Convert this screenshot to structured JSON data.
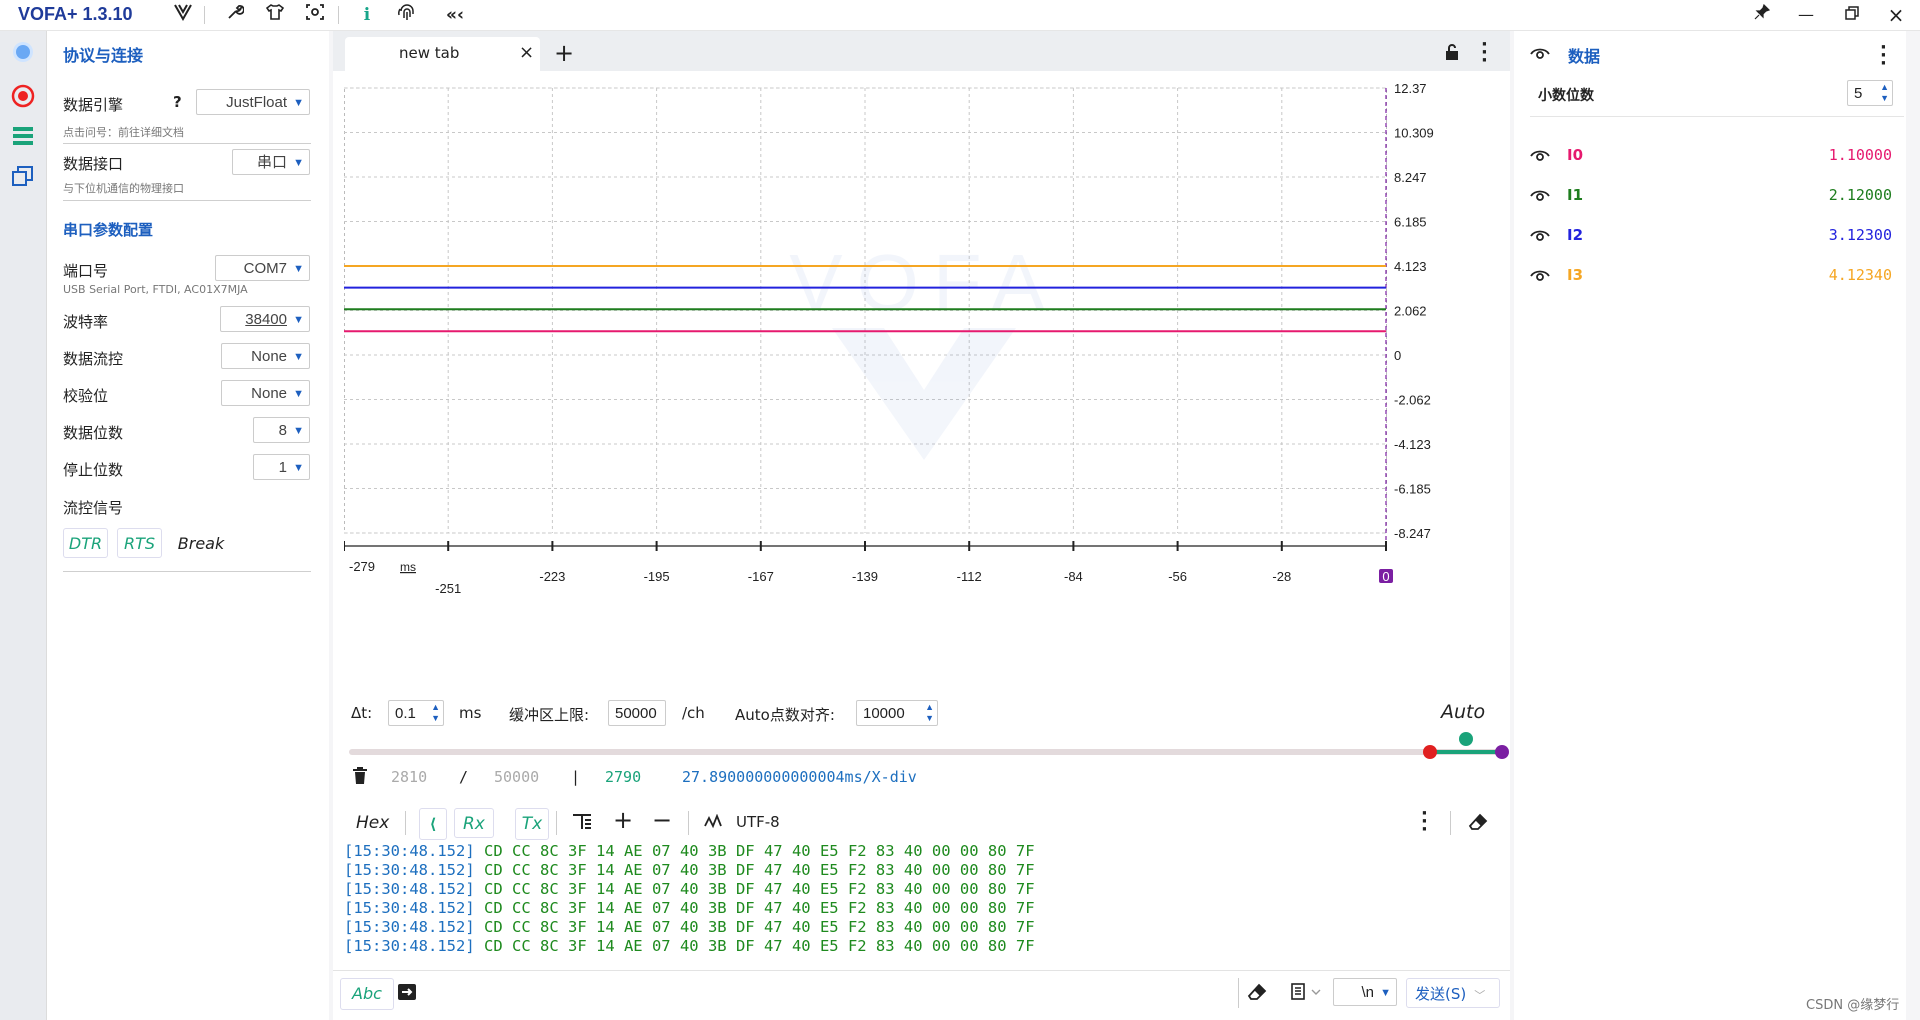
{
  "titlebar": {
    "app_name": "VOFA+ 1.3.10",
    "icons": [
      "vofa-logo-icon",
      "wrench-icon",
      "shirt-icon",
      "capture-icon",
      "info-icon",
      "fingerprint-icon",
      "collapse-icon"
    ],
    "window_buttons": [
      "pin-icon",
      "minimize-icon",
      "restore-icon",
      "close-icon"
    ]
  },
  "left": {
    "section_title": "协议与连接",
    "engine_label": "数据引擎",
    "engine_help": "?",
    "engine_value": "JustFloat",
    "engine_hint": "点击问号：前往详细文档",
    "iface_label": "数据接口",
    "iface_value": "串口",
    "iface_hint": "与下位机通信的物理接口",
    "serial_title": "串口参数配置",
    "port_label": "端口号",
    "port_value": "COM7",
    "port_hint": "USB Serial Port, FTDI, AC01X7MJA",
    "baud_label": "波特率",
    "baud_value": "38400",
    "flow_label": "数据流控",
    "flow_value": "None",
    "parity_label": "校验位",
    "parity_value": "None",
    "databits_label": "数据位数",
    "databits_value": "8",
    "stopbits_label": "停止位数",
    "stopbits_value": "1",
    "signal_label": "流控信号",
    "dtr": "DTR",
    "rts": "RTS",
    "brk": "Break"
  },
  "tab": {
    "name": "new tab",
    "close": "×",
    "add": "+"
  },
  "chart_data": {
    "type": "line",
    "title": "",
    "xlabel": "ms",
    "ylabel": "",
    "x_ticks": [
      "-279",
      "-251",
      "-223",
      "-195",
      "-167",
      "-139",
      "-112",
      "-84",
      "-56",
      "-28",
      "0"
    ],
    "y_ticks": [
      "12.37",
      "10.309",
      "8.247",
      "6.185",
      "4.123",
      "2.062",
      "0",
      "-2.062",
      "-4.123",
      "-6.185",
      "-8.247"
    ],
    "ylim": [
      -8.247,
      12.37
    ],
    "xlim": [
      -279,
      0
    ],
    "series": [
      {
        "name": "I0",
        "color": "#e6196e",
        "values": [
          1.1,
          1.1
        ]
      },
      {
        "name": "I1",
        "color": "#1e7d1e",
        "values": [
          2.12,
          2.12
        ]
      },
      {
        "name": "I2",
        "color": "#2222dd",
        "values": [
          3.123,
          3.123
        ]
      },
      {
        "name": "I3",
        "color": "#f5a623",
        "values": [
          4.1234,
          4.1234
        ]
      }
    ],
    "x": [
      -279,
      0
    ],
    "grid": true,
    "watermark": "VOFA"
  },
  "controls": {
    "dt_label": "Δt:",
    "dt_value": "0.1",
    "dt_unit": "ms",
    "buffer_label": "缓冲区上限:",
    "buffer_value": "50000",
    "buffer_unit": "/ch",
    "auto_label": "Auto点数对齐:",
    "auto_value": "10000",
    "auto_mode": "Auto"
  },
  "status": {
    "count1": "2810",
    "slash": "/",
    "count2": "50000",
    "bar": "|",
    "count3": "2790",
    "xdiv": "27.890000000000004ms/X-div"
  },
  "console_toolbar": {
    "hex": "Hex",
    "rx": "Rx",
    "tx": "Tx",
    "encoding": "UTF-8"
  },
  "console_rows": [
    {
      "ts": "[15:30:48.152]",
      "hex": "CD CC 8C 3F 14 AE 07 40 3B DF 47 40 E5 F2 83 40 00 00 80 7F"
    },
    {
      "ts": "[15:30:48.152]",
      "hex": "CD CC 8C 3F 14 AE 07 40 3B DF 47 40 E5 F2 83 40 00 00 80 7F"
    },
    {
      "ts": "[15:30:48.152]",
      "hex": "CD CC 8C 3F 14 AE 07 40 3B DF 47 40 E5 F2 83 40 00 00 80 7F"
    },
    {
      "ts": "[15:30:48.152]",
      "hex": "CD CC 8C 3F 14 AE 07 40 3B DF 47 40 E5 F2 83 40 00 00 80 7F"
    },
    {
      "ts": "[15:30:48.152]",
      "hex": "CD CC 8C 3F 14 AE 07 40 3B DF 47 40 E5 F2 83 40 00 00 80 7F"
    },
    {
      "ts": "[15:30:48.152]",
      "hex": "CD CC 8C 3F 14 AE 07 40 3B DF 47 40 E5 F2 83 40 00 00 80 7F"
    }
  ],
  "send_bar": {
    "abc": "Abc",
    "newline": "\\n",
    "send": "发送(S)"
  },
  "right": {
    "title": "数据",
    "decimals_label": "小数位数",
    "decimals_value": "5",
    "channels": [
      {
        "name": "I0",
        "value": "1.10000",
        "color": "#e6196e"
      },
      {
        "name": "I1",
        "value": "2.12000",
        "color": "#1e7d1e"
      },
      {
        "name": "I2",
        "value": "3.12300",
        "color": "#2222dd"
      },
      {
        "name": "I3",
        "value": "4.12340",
        "color": "#f5a623"
      }
    ]
  },
  "footer": {
    "credit": "CSDN @缘梦行"
  }
}
